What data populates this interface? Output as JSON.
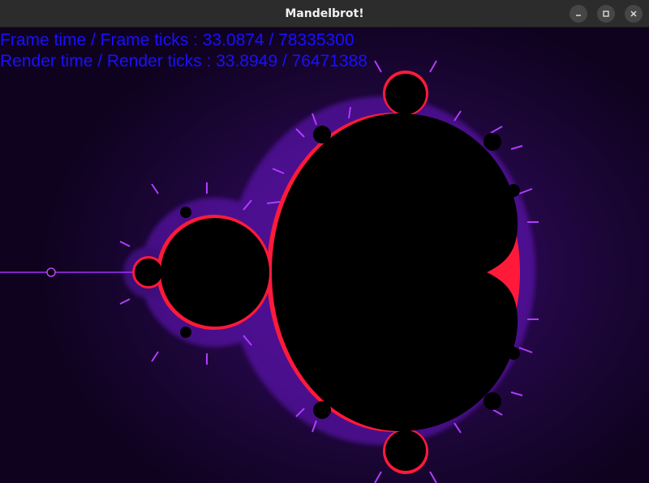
{
  "window": {
    "title": "Mandelbrot!",
    "controls": {
      "minimize_icon": "minimize-icon",
      "maximize_icon": "maximize-icon",
      "close_icon": "close-icon"
    }
  },
  "overlay": {
    "frame_line": "Frame time / Frame ticks : 33.0874 / 78335300",
    "render_line": "Render time / Render ticks : 33.8949 / 76471388",
    "text_color": "#1a10ff"
  },
  "colors": {
    "titlebar": "#2c2c2c",
    "set_fill": "#000000",
    "glow_inner": "#3a0a6e",
    "glow_outer": "#0f021f",
    "edge_purple": "#a020f0",
    "edge_red": "#ff1030"
  }
}
